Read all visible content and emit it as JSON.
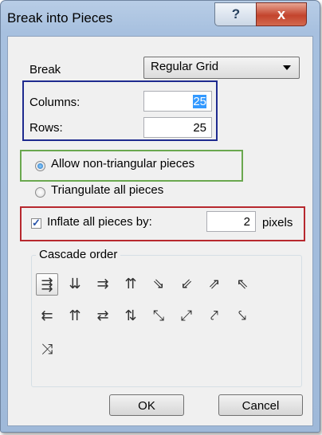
{
  "window": {
    "title": "Break into Pieces",
    "help_icon": "?",
    "close_icon": "x"
  },
  "break": {
    "label": "Break",
    "selected": "Regular Grid"
  },
  "columns": {
    "label": "Columns:",
    "value": "25"
  },
  "rows": {
    "label": "Rows:",
    "value": "25"
  },
  "options": {
    "allow_nontriangular": {
      "label": "Allow non-triangular pieces",
      "checked": true
    },
    "triangulate": {
      "label": "Triangulate all pieces",
      "checked": false
    }
  },
  "inflate": {
    "label": "Inflate all pieces by:",
    "checked": true,
    "value": "2",
    "unit": "pixels"
  },
  "cascade": {
    "title": "Cascade order",
    "rows": [
      [
        "⇶",
        "⇊",
        "⇉",
        "⇈",
        "⇘",
        "⇙",
        "⇗",
        "⇖"
      ],
      [
        "⇇",
        "⇈",
        "⇄",
        "⇅",
        "⤡",
        "⤢",
        "⤤",
        "⤥"
      ],
      [
        "⤨"
      ]
    ]
  },
  "buttons": {
    "ok": "OK",
    "cancel": "Cancel"
  },
  "colors": {
    "highlight_blue": "#1f2b8f",
    "highlight_green": "#6aa84f",
    "highlight_red": "#b7282e"
  }
}
